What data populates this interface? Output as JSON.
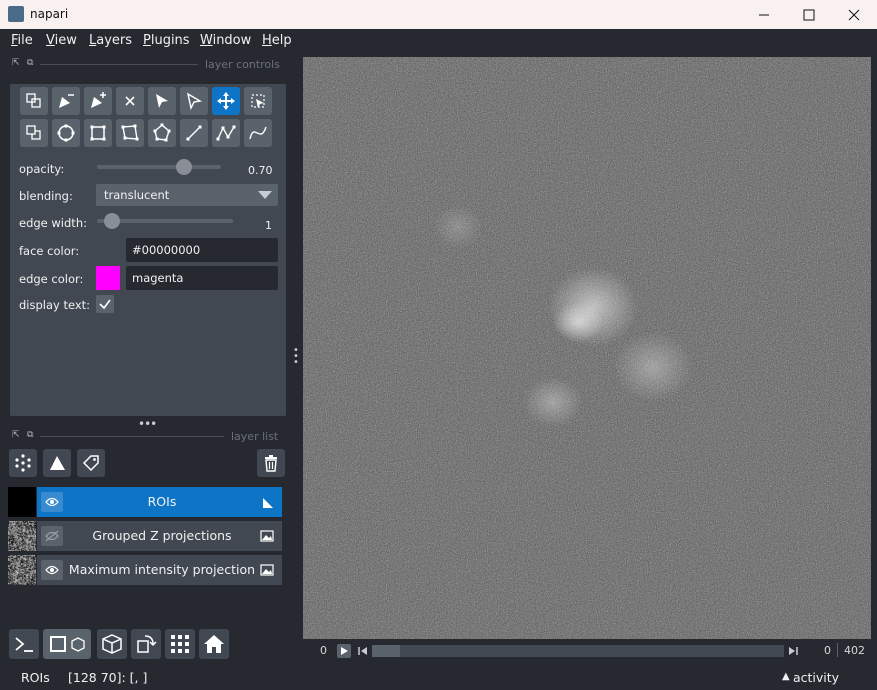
{
  "window": {
    "title": "napari",
    "controls": [
      "minimize",
      "maximize",
      "close"
    ]
  },
  "menu": {
    "items": [
      {
        "label": "File",
        "mnemonic": "F",
        "rest": "ile"
      },
      {
        "label": "View",
        "mnemonic": "V",
        "rest": "iew"
      },
      {
        "label": "Layers",
        "mnemonic": "L",
        "rest": "ayers"
      },
      {
        "label": "Plugins",
        "mnemonic": "P",
        "rest": "lugins"
      },
      {
        "label": "Window",
        "mnemonic": "W",
        "rest": "indow"
      },
      {
        "label": "Help",
        "mnemonic": "H",
        "rest": "elp"
      }
    ]
  },
  "layer_controls": {
    "section_title": "layer controls",
    "opacity": {
      "label": "opacity:",
      "value": "0.70",
      "fraction": 0.7
    },
    "blending": {
      "label": "blending:",
      "value": "translucent"
    },
    "edge_width": {
      "label": "edge width:",
      "value": "1",
      "fraction": 0.04
    },
    "face_color": {
      "label": "face color:",
      "value": "#00000000"
    },
    "edge_color": {
      "label": "edge color:",
      "value": "magenta",
      "swatch": "#ff00ff"
    },
    "display_text": {
      "label": "display text:",
      "checked": true
    }
  },
  "layer_list": {
    "section_title": "layer list",
    "layers": [
      {
        "name": "ROIs",
        "selected": true,
        "visible": true,
        "type": "shapes"
      },
      {
        "name": "Grouped Z projections",
        "selected": false,
        "visible": false,
        "type": "image"
      },
      {
        "name": "Maximum intensity projection",
        "selected": false,
        "visible": true,
        "type": "image"
      }
    ]
  },
  "dims": {
    "axis_label": "0",
    "current": "0",
    "max": "402"
  },
  "status": {
    "layer": "ROIs",
    "coords": "[128 70]: [, ]",
    "activity": "activity"
  },
  "colors": {
    "accent": "#0d74c6",
    "background": "#262930",
    "panel": "#414851",
    "button": "#5a626c"
  }
}
